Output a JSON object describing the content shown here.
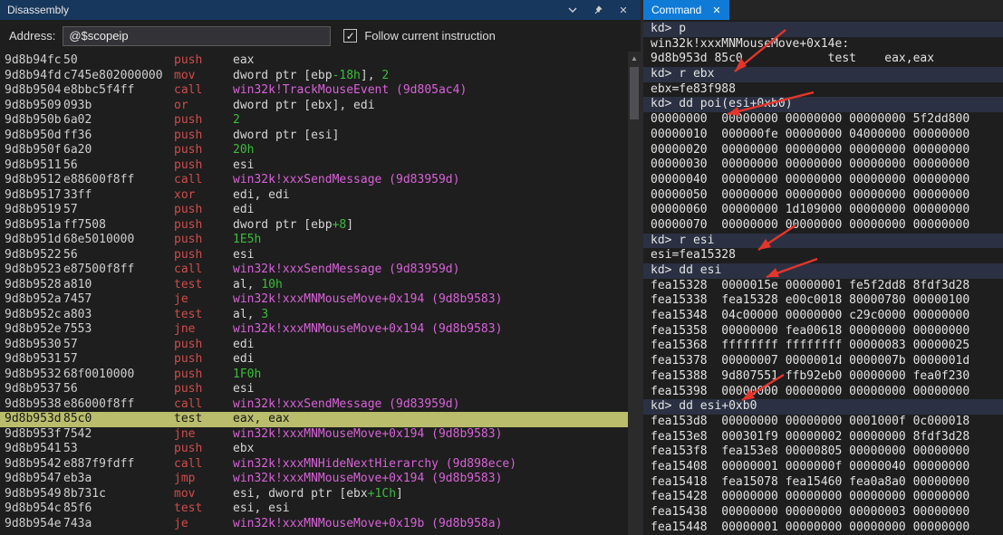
{
  "colors": {
    "title_navy": "#17375c",
    "accent_blue": "#0f7bd7",
    "hl_yellow": "#b9bd6c",
    "mn_red": "#cf4c4c",
    "num_green": "#3dbb3d",
    "sym_magenta": "#d862d8",
    "arrow_red": "#e5352b",
    "input_line_bg": "#2b3143"
  },
  "icons": {
    "close": "✕",
    "check": "✓",
    "up_arrow": "▲"
  },
  "disassembly_panel": {
    "title": "Disassembly",
    "address_label": "Address:",
    "address_value": "@$scopeip",
    "follow_label": "Follow current instruction",
    "follow_checked": true,
    "lines": [
      {
        "addr": "9d8b94fc",
        "bytes": "50",
        "mn": "push",
        "ops": [
          {
            "t": "eax"
          }
        ]
      },
      {
        "addr": "9d8b94fd",
        "bytes": "c745e802000000",
        "mn": "mov",
        "ops": [
          {
            "t": "dword ptr [ebp"
          },
          {
            "t": "-18h",
            "k": "n"
          },
          {
            "t": "], "
          },
          {
            "t": "2",
            "k": "n"
          }
        ]
      },
      {
        "addr": "9d8b9504",
        "bytes": "e8bbc5f4ff",
        "mn": "call",
        "ops": [
          {
            "t": "win32k!TrackMouseEvent (9d805ac4)",
            "k": "s"
          }
        ]
      },
      {
        "addr": "9d8b9509",
        "bytes": "093b",
        "mn": "or",
        "ops": [
          {
            "t": "dword ptr [ebx], edi"
          }
        ]
      },
      {
        "addr": "9d8b950b",
        "bytes": "6a02",
        "mn": "push",
        "ops": [
          {
            "t": "2",
            "k": "n"
          }
        ]
      },
      {
        "addr": "9d8b950d",
        "bytes": "ff36",
        "mn": "push",
        "ops": [
          {
            "t": "dword ptr [esi]"
          }
        ]
      },
      {
        "addr": "9d8b950f",
        "bytes": "6a20",
        "mn": "push",
        "ops": [
          {
            "t": "20h",
            "k": "n"
          }
        ]
      },
      {
        "addr": "9d8b9511",
        "bytes": "56",
        "mn": "push",
        "ops": [
          {
            "t": "esi"
          }
        ]
      },
      {
        "addr": "9d8b9512",
        "bytes": "e88600f8ff",
        "mn": "call",
        "ops": [
          {
            "t": "win32k!xxxSendMessage (9d83959d)",
            "k": "s"
          }
        ]
      },
      {
        "addr": "9d8b9517",
        "bytes": "33ff",
        "mn": "xor",
        "ops": [
          {
            "t": "edi, edi"
          }
        ]
      },
      {
        "addr": "9d8b9519",
        "bytes": "57",
        "mn": "push",
        "ops": [
          {
            "t": "edi"
          }
        ]
      },
      {
        "addr": "9d8b951a",
        "bytes": "ff7508",
        "mn": "push",
        "ops": [
          {
            "t": "dword ptr [ebp"
          },
          {
            "t": "+8",
            "k": "n"
          },
          {
            "t": "]"
          }
        ]
      },
      {
        "addr": "9d8b951d",
        "bytes": "68e5010000",
        "mn": "push",
        "ops": [
          {
            "t": "1E5h",
            "k": "n"
          }
        ]
      },
      {
        "addr": "9d8b9522",
        "bytes": "56",
        "mn": "push",
        "ops": [
          {
            "t": "esi"
          }
        ]
      },
      {
        "addr": "9d8b9523",
        "bytes": "e87500f8ff",
        "mn": "call",
        "ops": [
          {
            "t": "win32k!xxxSendMessage (9d83959d)",
            "k": "s"
          }
        ]
      },
      {
        "addr": "9d8b9528",
        "bytes": "a810",
        "mn": "test",
        "ops": [
          {
            "t": "al, "
          },
          {
            "t": "10h",
            "k": "n"
          }
        ]
      },
      {
        "addr": "9d8b952a",
        "bytes": "7457",
        "mn": "je",
        "ops": [
          {
            "t": "win32k!xxxMNMouseMove+0x194 (9d8b9583)",
            "k": "s"
          }
        ]
      },
      {
        "addr": "9d8b952c",
        "bytes": "a803",
        "mn": "test",
        "ops": [
          {
            "t": "al, "
          },
          {
            "t": "3",
            "k": "n"
          }
        ]
      },
      {
        "addr": "9d8b952e",
        "bytes": "7553",
        "mn": "jne",
        "ops": [
          {
            "t": "win32k!xxxMNMouseMove+0x194 (9d8b9583)",
            "k": "s"
          }
        ]
      },
      {
        "addr": "9d8b9530",
        "bytes": "57",
        "mn": "push",
        "ops": [
          {
            "t": "edi"
          }
        ]
      },
      {
        "addr": "9d8b9531",
        "bytes": "57",
        "mn": "push",
        "ops": [
          {
            "t": "edi"
          }
        ]
      },
      {
        "addr": "9d8b9532",
        "bytes": "68f0010000",
        "mn": "push",
        "ops": [
          {
            "t": "1F0h",
            "k": "n"
          }
        ]
      },
      {
        "addr": "9d8b9537",
        "bytes": "56",
        "mn": "push",
        "ops": [
          {
            "t": "esi"
          }
        ]
      },
      {
        "addr": "9d8b9538",
        "bytes": "e86000f8ff",
        "mn": "call",
        "ops": [
          {
            "t": "win32k!xxxSendMessage (9d83959d)",
            "k": "s"
          }
        ]
      },
      {
        "addr": "9d8b953d",
        "bytes": "85c0",
        "mn": "test",
        "ops": [
          {
            "t": "eax, eax"
          }
        ],
        "hl": true
      },
      {
        "addr": "9d8b953f",
        "bytes": "7542",
        "mn": "jne",
        "ops": [
          {
            "t": "win32k!xxxMNMouseMove+0x194 (9d8b9583)",
            "k": "s"
          }
        ]
      },
      {
        "addr": "9d8b9541",
        "bytes": "53",
        "mn": "push",
        "ops": [
          {
            "t": "ebx"
          }
        ]
      },
      {
        "addr": "9d8b9542",
        "bytes": "e887f9fdff",
        "mn": "call",
        "ops": [
          {
            "t": "win32k!xxxMNHideNextHierarchy (9d898ece)",
            "k": "s"
          }
        ]
      },
      {
        "addr": "9d8b9547",
        "bytes": "eb3a",
        "mn": "jmp",
        "ops": [
          {
            "t": "win32k!xxxMNMouseMove+0x194 (9d8b9583)",
            "k": "s"
          }
        ]
      },
      {
        "addr": "9d8b9549",
        "bytes": "8b731c",
        "mn": "mov",
        "ops": [
          {
            "t": "esi, dword ptr [ebx"
          },
          {
            "t": "+1Ch",
            "k": "n"
          },
          {
            "t": "]"
          }
        ]
      },
      {
        "addr": "9d8b954c",
        "bytes": "85f6",
        "mn": "test",
        "ops": [
          {
            "t": "esi, esi"
          }
        ]
      },
      {
        "addr": "9d8b954e",
        "bytes": "743a",
        "mn": "je",
        "ops": [
          {
            "t": "win32k!xxxMNMouseMove+0x19b (9d8b958a)",
            "k": "s"
          }
        ]
      }
    ]
  },
  "command_panel": {
    "tab_title": "Command",
    "lines": [
      {
        "text": "kd> p",
        "input": true
      },
      {
        "text": "win32k!xxxMNMouseMove+0x14e:"
      },
      {
        "text": "9d8b953d 85c0            test    eax,eax"
      },
      {
        "text": "kd> r ebx",
        "input": true
      },
      {
        "text": "ebx=fe83f988"
      },
      {
        "text": "kd> dd poi(esi+0xb0)",
        "input": true
      },
      {
        "text": "00000000  00000000 00000000 00000000 5f2dd800"
      },
      {
        "text": "00000010  000000fe 00000000 04000000 00000000"
      },
      {
        "text": "00000020  00000000 00000000 00000000 00000000"
      },
      {
        "text": "00000030  00000000 00000000 00000000 00000000"
      },
      {
        "text": "00000040  00000000 00000000 00000000 00000000"
      },
      {
        "text": "00000050  00000000 00000000 00000000 00000000"
      },
      {
        "text": "00000060  00000000 1d109000 00000000 00000000"
      },
      {
        "text": "00000070  00000000 00000000 00000000 00000000"
      },
      {
        "text": "kd> r esi",
        "input": true
      },
      {
        "text": "esi=fea15328"
      },
      {
        "text": "kd> dd esi",
        "input": true
      },
      {
        "text": "fea15328  0000015e 00000001 fe5f2dd8 8fdf3d28"
      },
      {
        "text": "fea15338  fea15328 e00c0018 80000780 00000100"
      },
      {
        "text": "fea15348  04c00000 00000000 c29c0000 00000000"
      },
      {
        "text": "fea15358  00000000 fea00618 00000000 00000000"
      },
      {
        "text": "fea15368  ffffffff ffffffff 00000083 00000025"
      },
      {
        "text": "fea15378  00000007 0000001d 0000007b 0000001d"
      },
      {
        "text": "fea15388  9d807551 ffb92eb0 00000000 fea0f230"
      },
      {
        "text": "fea15398  00000000 00000000 00000000 00000000"
      },
      {
        "text": "kd> dd esi+0xb0",
        "input": true
      },
      {
        "text": "fea153d8  00000000 00000000 0001000f 0c000018"
      },
      {
        "text": "fea153e8  000301f9 00000002 00000000 8fdf3d28"
      },
      {
        "text": "fea153f8  fea153e8 00000805 00000000 00000000"
      },
      {
        "text": "fea15408  00000001 0000000f 00000040 00000000"
      },
      {
        "text": "fea15418  fea15078 fea15460 fea0a8a0 00000000"
      },
      {
        "text": "fea15428  00000000 00000000 00000000 00000000"
      },
      {
        "text": "fea15438  00000000 00000000 00000003 00000000"
      },
      {
        "text": "fea15448  00000001 00000000 00000000 00000000"
      }
    ]
  }
}
